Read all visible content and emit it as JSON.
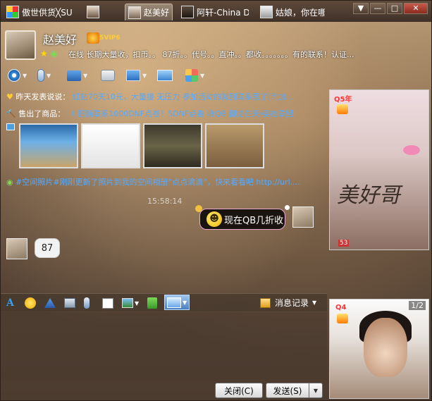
{
  "tabs": [
    {
      "label": "傲世供货╳SU",
      "icon": "qq-color-icon"
    },
    {
      "label": "",
      "icon": "contact-photo-icon"
    },
    {
      "label": "赵美好",
      "icon": "contact-photo-icon",
      "active": true
    },
    {
      "label": "阿轩-China Drc",
      "icon": "contact-photo-icon"
    },
    {
      "label": "姑娘，你在哪",
      "icon": "contact-photo-icon"
    }
  ],
  "window_controls": {
    "menu": "▼",
    "minimize": "—",
    "maximize": "□",
    "close": "✕"
  },
  "contact": {
    "name": "赵美好",
    "vip_label": "SVIP6",
    "signature": "在线  长期大量收，扣币。。  87折。。代号。。直冲。。都收。。。。。。。有的联系！认证..."
  },
  "toolbar": [
    {
      "icon": "video-call-icon"
    },
    {
      "icon": "voice-call-icon"
    },
    {
      "icon": "send-file-icon"
    },
    {
      "icon": "create-discussion-icon"
    },
    {
      "icon": "remote-assist-icon"
    },
    {
      "icon": "share-screen-icon"
    },
    {
      "icon": "apps-grid-icon"
    }
  ],
  "feed": {
    "line1_label": "昨天发表说说：",
    "line1_text": "红钻70天10元，大量接 无压力 参加活动的就别联系我了[附加...",
    "line2_label": "售出了商品：",
    "line2_text": "《 招前联系1000DNF点卷！5DNF点卷 收QB 御龙在天/英雄联盟",
    "line3_text": "#空间照片#刚刚更新了照片到我的空间相册“点点滴滴”，快来看看吧  http://url...."
  },
  "chat": {
    "timestamp": "15:58:14",
    "outgoing": "现在QB几折收",
    "incoming": "87"
  },
  "input_toolbar": {
    "history_label": "消息记录",
    "icons": [
      "font-icon",
      "emoji-icon",
      "magic-icon",
      "shake-icon",
      "voice-msg-icon",
      "doodle-icon",
      "image-icon",
      "red-packet-icon",
      "screenshot-icon"
    ]
  },
  "photo_panel": {
    "top_badge": "Q5年",
    "top_signature_art": "美好哥",
    "top_number": "53",
    "bottom_counter": "1/2",
    "bottom_badge": "Q4"
  },
  "buttons": {
    "close": "关闭(C)",
    "send": "发送(S)",
    "send_dropdown": "▼"
  }
}
